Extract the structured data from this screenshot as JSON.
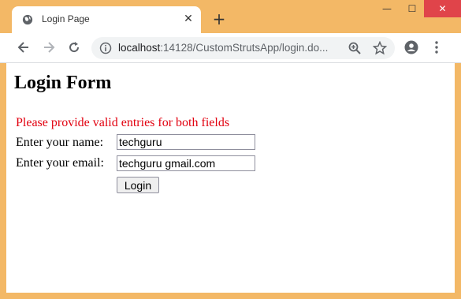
{
  "browser": {
    "tab_title": "Login Page",
    "new_tab_symbol": "+",
    "close_tab_symbol": "✕",
    "url_host": "localhost",
    "url_path": ":14128/CustomStrutsApp/login.do...",
    "window_close_symbol": "✕",
    "window_max_symbol": "☐",
    "window_min_symbol": "—"
  },
  "page": {
    "heading": "Login Form",
    "error_message": "Please provide valid entries for both fields",
    "name_label": "Enter your name:",
    "name_value": "techguru",
    "email_label": "Enter your email:",
    "email_value": "techguru gmail.com",
    "login_button": "Login"
  },
  "colors": {
    "window_frame": "#f3b866",
    "error_text": "#e2000f",
    "close_button": "#e0444a"
  }
}
